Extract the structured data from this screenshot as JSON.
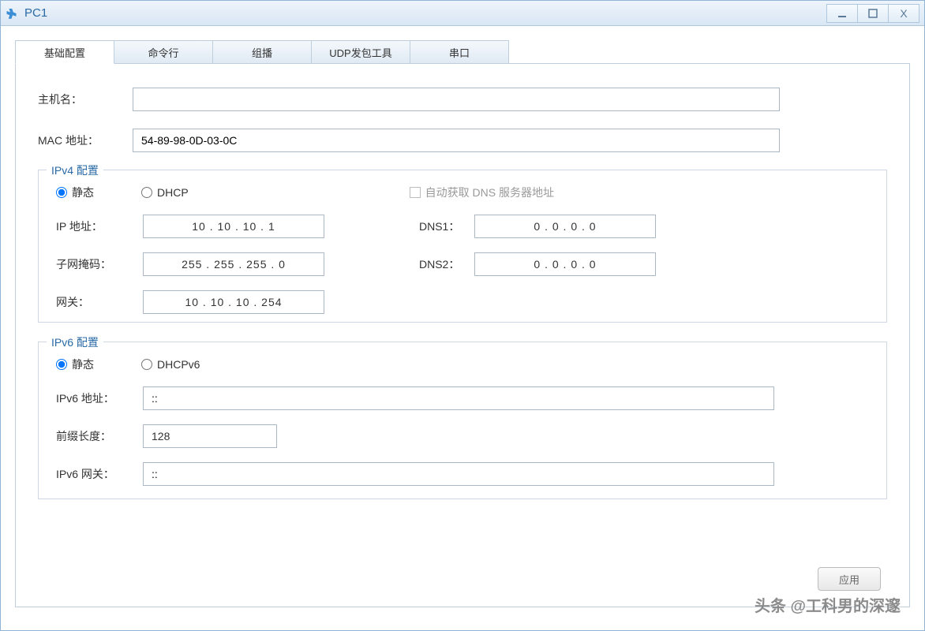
{
  "window": {
    "title": "PC1"
  },
  "tabs": [
    "基础配置",
    "命令行",
    "组播",
    "UDP发包工具",
    "串口"
  ],
  "active_tab": 0,
  "basic": {
    "hostname_label": "主机名：",
    "hostname_value": "",
    "mac_label": "MAC 地址：",
    "mac_value": "54-89-98-0D-03-0C"
  },
  "ipv4": {
    "legend": "IPv4 配置",
    "static_label": "静态",
    "dhcp_label": "DHCP",
    "auto_dns_label": "自动获取 DNS 服务器地址",
    "mode": "static",
    "ip_label": "IP 地址：",
    "ip_value": "10   .   10   .   10   .   1",
    "mask_label": "子网掩码：",
    "mask_value": "255   .  255   .  255   .   0",
    "gw_label": "网关：",
    "gw_value": "10   .   10   .   10   .  254",
    "dns1_label": "DNS1：",
    "dns1_value": "0   .   0   .   0   .   0",
    "dns2_label": "DNS2：",
    "dns2_value": "0   .   0   .   0   .   0"
  },
  "ipv6": {
    "legend": "IPv6 配置",
    "static_label": "静态",
    "dhcp_label": "DHCPv6",
    "mode": "static",
    "addr_label": "IPv6 地址：",
    "addr_value": "::",
    "prefix_label": "前缀长度：",
    "prefix_value": "128",
    "gw_label": "IPv6 网关：",
    "gw_value": "::"
  },
  "apply_label": "应用",
  "watermark": "头条 @工科男的深邃"
}
